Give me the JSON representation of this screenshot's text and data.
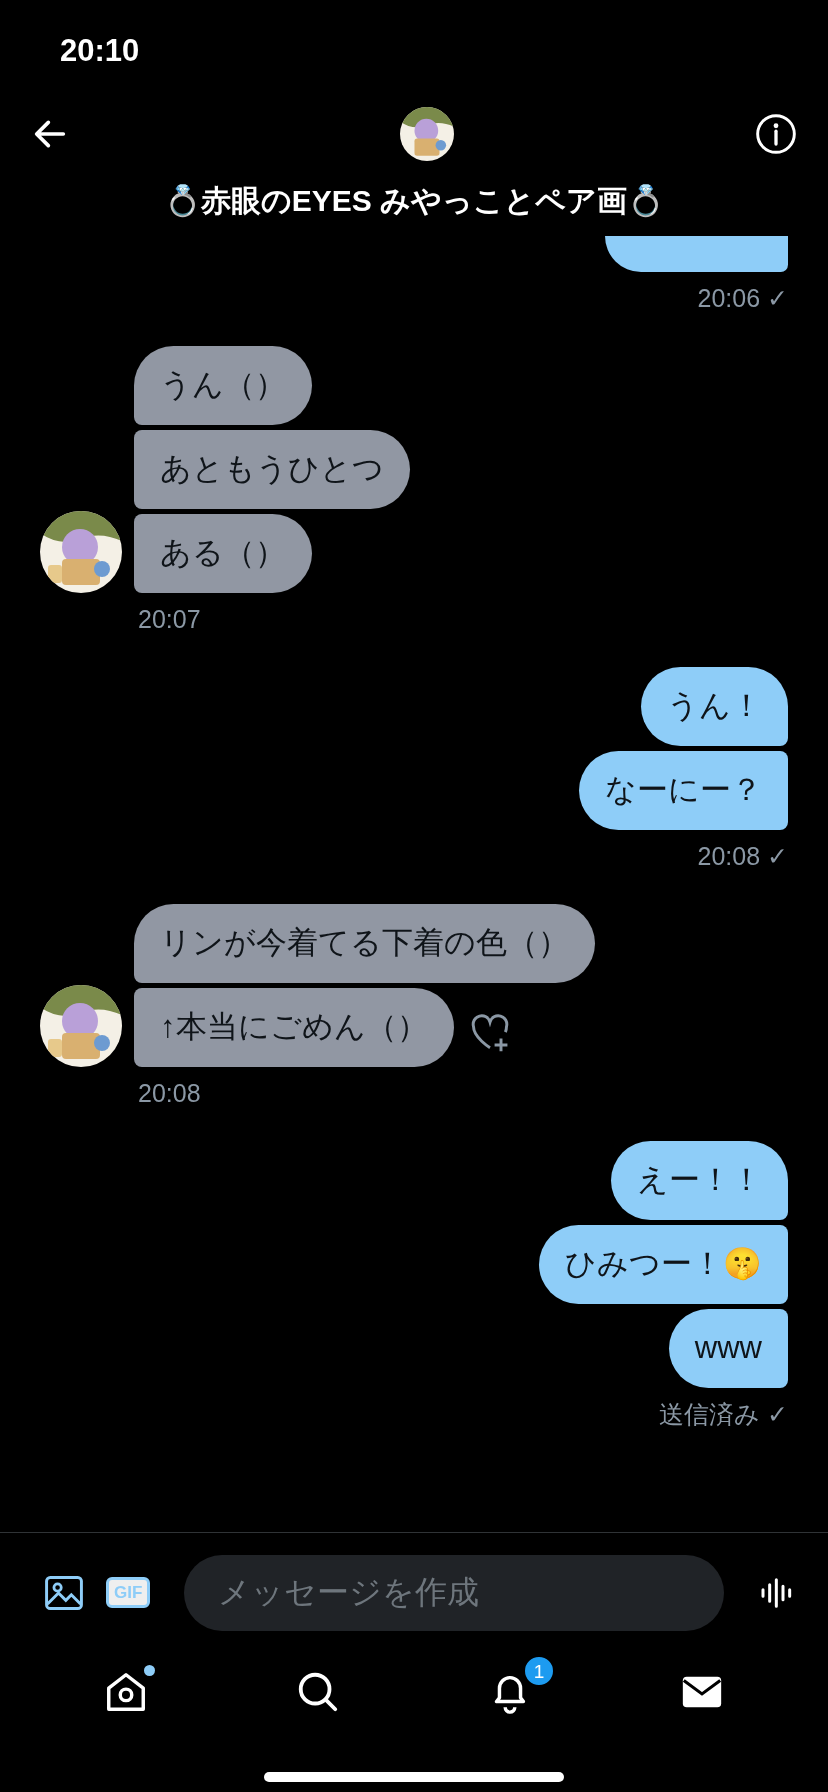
{
  "status_bar": {
    "time": "20:10"
  },
  "header": {
    "title": "💍赤眼のEYES みやっことペア画💍"
  },
  "messages": [
    {
      "kind": "sent",
      "cut": true,
      "time": "20:06 ✓"
    },
    {
      "kind": "received",
      "reaction": false,
      "bubbles": [
        "うん（）",
        "あともうひとつ",
        "ある（）"
      ],
      "time": "20:07"
    },
    {
      "kind": "sent",
      "bubbles": [
        "うん！",
        "なーにー？"
      ],
      "time": "20:08 ✓"
    },
    {
      "kind": "received",
      "reaction": true,
      "bubbles": [
        "リンが今着てる下着の色（）",
        "↑本当にごめん（）"
      ],
      "time": "20:08"
    },
    {
      "kind": "sent",
      "bubbles": [
        "えー！！",
        "ひみつー！🤫",
        "www"
      ],
      "time": "送信済み ✓"
    }
  ],
  "composer": {
    "gif_label": "GIF",
    "placeholder": "メッセージを作成"
  },
  "nav": [
    {
      "kind": "home",
      "dot": true
    },
    {
      "kind": "search",
      "dot": false
    },
    {
      "kind": "notifications",
      "dot": false,
      "badge": "1"
    },
    {
      "kind": "messages",
      "dot": false
    }
  ]
}
